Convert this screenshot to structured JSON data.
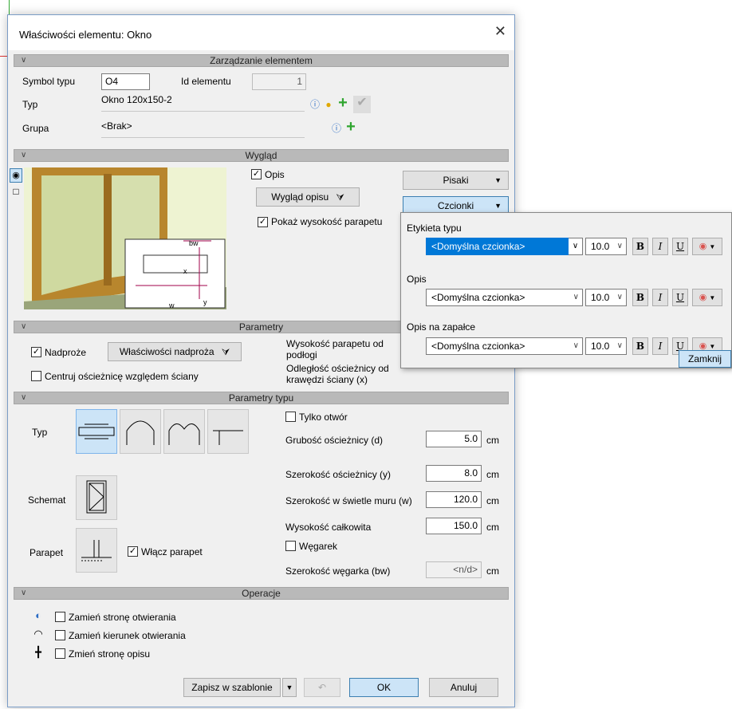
{
  "window": {
    "title": "Właściwości elementu: Okno",
    "close_glyph": "✕"
  },
  "sections": {
    "zarzadzanie": "Zarządzanie elementem",
    "wyglad": "Wygląd",
    "parametry": "Parametry",
    "parametry_typu": "Parametry typu",
    "operacje": "Operacje"
  },
  "management": {
    "symbol_label": "Symbol typu",
    "symbol_value": "O4",
    "id_label": "Id elementu",
    "id_value": "1",
    "typ_label": "Typ",
    "typ_value": "Okno 120x150-2",
    "grupa_label": "Grupa",
    "grupa_value": "<Brak>"
  },
  "appearance": {
    "opis_label": "Opis",
    "opis_checked": true,
    "wyglad_opisu_btn": "Wygląd opisu",
    "pokaz_label": "Pokaż wysokość parapetu",
    "pokaz_checked": true,
    "pisaki_btn": "Pisaki",
    "czcionki_btn": "Czcionki"
  },
  "parametry": {
    "nadproze_label": "Nadproże",
    "nadproze_checked": true,
    "wlasciwosci_nadproza_btn": "Właściwości nadproża",
    "centruj_label": "Centruj ościeżnicę względem ściany",
    "centruj_checked": false,
    "wys_parapetu_label": "Wysokość parapetu od podłogi",
    "odleglosc_label": "Odległość ościeżnicy od krawędzi ściany (x)"
  },
  "type_params": {
    "typ_label": "Typ",
    "schemat_label": "Schemat",
    "parapet_label": "Parapet",
    "wlacz_parapet_label": "Włącz parapet",
    "wlacz_parapet_checked": true,
    "tylko_otwor_label": "Tylko otwór",
    "tylko_otwor_checked": false,
    "grubosc_label": "Grubość ościeżnicy (d)",
    "grubosc_value": "5.0",
    "szerokosc_osc_label": "Szerokość ościeżnicy (y)",
    "szerokosc_osc_value": "8.0",
    "szerokosc_muru_label": "Szerokość w świetle muru (w)",
    "szerokosc_muru_value": "120.0",
    "wysokosc_label": "Wysokość całkowita",
    "wysokosc_value": "150.0",
    "wegarek_label": "Węgarek",
    "wegarek_checked": false,
    "szer_wegarka_label": "Szerokość węgarka (bw)",
    "szer_wegarka_value": "<n/d>",
    "unit": "cm"
  },
  "operations": {
    "zamien_strone_label": "Zamień stronę otwierania",
    "zamien_kierunek_label": "Zamień kierunek otwierania",
    "zmien_opis_label": "Zmień stronę opisu"
  },
  "footer": {
    "zapisz_btn": "Zapisz w szablonie",
    "ok_btn": "OK",
    "anuluj_btn": "Anuluj"
  },
  "font_popup": {
    "rows": [
      {
        "label": "Etykieta typu",
        "font": "<Domyślna czcionka>",
        "size": "10.0",
        "selected": true
      },
      {
        "label": "Opis",
        "font": "<Domyślna czcionka>",
        "size": "10.0",
        "selected": false
      },
      {
        "label": "Opis na zapałce",
        "font": "<Domyślna czcionka>",
        "size": "10.0",
        "selected": false
      }
    ],
    "bold": "B",
    "italic": "I",
    "underline": "U",
    "zamknij_btn": "Zamknij"
  },
  "dimension_labels": {
    "bw": "bw",
    "x": "x",
    "y": "y",
    "w": "w"
  },
  "colors": {
    "accent": "#0078d7",
    "section_bg": "#b9b9b9",
    "button_selected": "#cce4f7"
  }
}
